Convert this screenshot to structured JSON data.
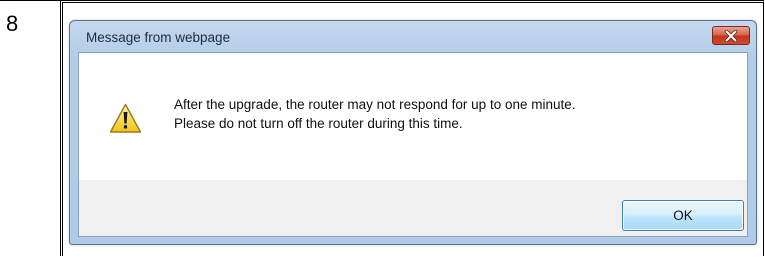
{
  "step": {
    "number": "8"
  },
  "dialog": {
    "title": "Message from webpage",
    "close_icon": "close-icon",
    "warning_icon": "warning-icon",
    "message_line1": "After the upgrade, the router may not respond for up to one minute.",
    "message_line2": "Please do not turn off the router during this time.",
    "ok_label": "OK"
  },
  "colors": {
    "titlebar": "#b3cde8",
    "close_button": "#c2351b",
    "warning_yellow": "#f7d430",
    "ok_button": "#bee6fd"
  }
}
